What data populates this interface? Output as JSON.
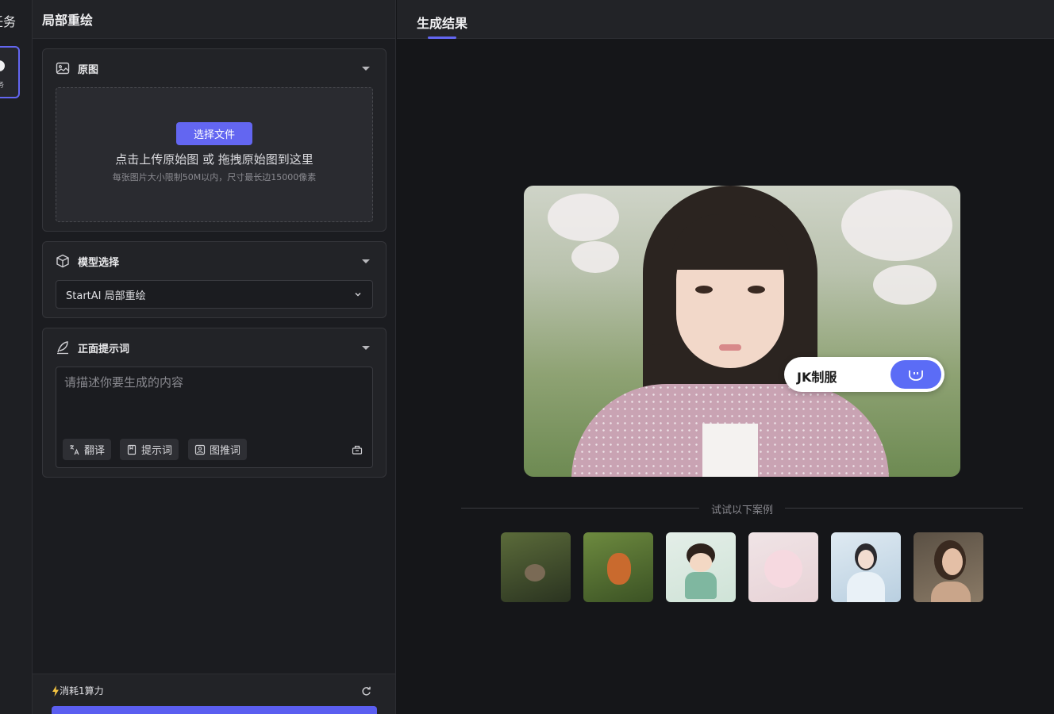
{
  "rail": {
    "title": "任务",
    "card_label": "务"
  },
  "panel": {
    "title": "局部重绘",
    "original": {
      "label": "原图",
      "button": "选择文件",
      "hint_main": "点击上传原始图 或 拖拽原始图到这里",
      "hint_sub": "每张图片大小限制50M以内，尺寸最长边15000像素"
    },
    "model": {
      "label": "模型选择",
      "selected": "StartAI 局部重绘"
    },
    "prompt": {
      "label": "正面提示词",
      "placeholder": "请描述你要生成的内容",
      "value": "",
      "chips": [
        "翻译",
        "提示词",
        "图推词"
      ]
    },
    "footer": {
      "cost": "消耗1算力"
    }
  },
  "result": {
    "tab": "生成结果",
    "tag_text": "JK制服",
    "examples_label": "试试以下案例",
    "examples": [
      "squirrel",
      "fox",
      "princess",
      "cat",
      "hanfu-girl",
      "portrait-woman"
    ]
  },
  "colors": {
    "accent": "#6366f1",
    "bg": "#151619",
    "panel": "#1b1c20"
  }
}
